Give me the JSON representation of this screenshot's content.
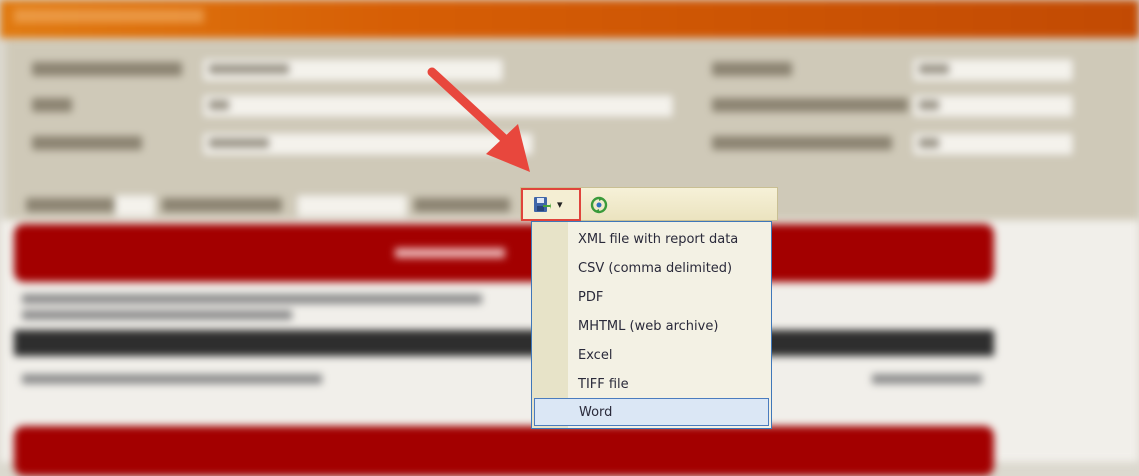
{
  "export_menu": {
    "items": [
      {
        "label": "XML file with report data",
        "highlighted": false
      },
      {
        "label": "CSV (comma delimited)",
        "highlighted": false
      },
      {
        "label": "PDF",
        "highlighted": false
      },
      {
        "label": "MHTML (web archive)",
        "highlighted": false
      },
      {
        "label": "Excel",
        "highlighted": false
      },
      {
        "label": "TIFF file",
        "highlighted": false
      },
      {
        "label": "Word",
        "highlighted": true
      }
    ]
  },
  "toolbar": {
    "export_icon": "save-icon",
    "caret_glyph": "▾",
    "refresh_icon": "refresh-icon"
  },
  "colors": {
    "header": "#d65e05",
    "accent_red": "#a30000",
    "highlight_border": "#e0443b",
    "menu_border": "#3f77b9",
    "arrow": "#e8473d"
  }
}
